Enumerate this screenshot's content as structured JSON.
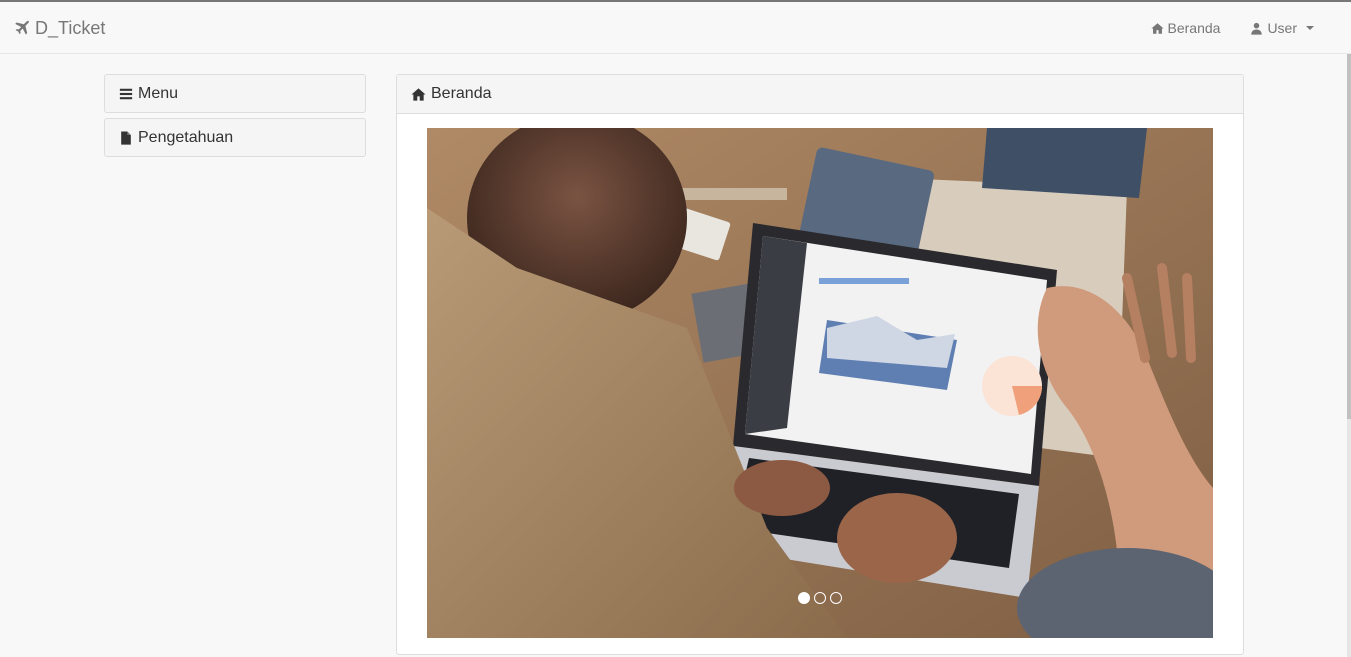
{
  "navbar": {
    "brand": "D_Ticket",
    "brand_icon": "plane-icon",
    "home_link": "Beranda",
    "home_icon": "home-icon",
    "user_menu": "User",
    "user_icon": "user-icon"
  },
  "sidebar": {
    "items": [
      {
        "label": "Menu",
        "icon": "bars-icon"
      },
      {
        "label": "Pengetahuan",
        "icon": "file-icon"
      }
    ]
  },
  "panel": {
    "title": "Beranda",
    "icon": "home-icon"
  },
  "carousel": {
    "slide_count": 3,
    "active_index": 0
  },
  "colors": {
    "navbar_bg": "#f8f8f8",
    "muted_text": "#777777",
    "panel_heading_bg": "#f5f5f5",
    "border": "#dddddd"
  }
}
